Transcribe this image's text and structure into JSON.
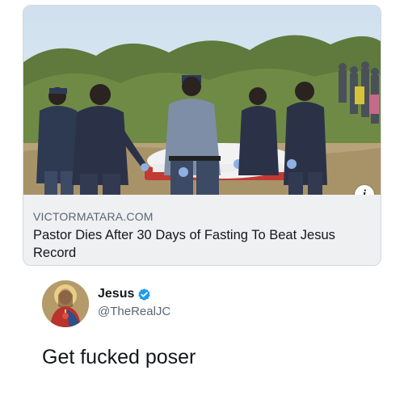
{
  "link_card": {
    "domain": "VICTORMATARA.COM",
    "title": "Pastor Dies After 30 Days of Fasting To Beat Jesus Record",
    "info_icon": "info-icon",
    "info_glyph": "i"
  },
  "reply": {
    "author_name": "Jesus",
    "author_handle": "@TheRealJC",
    "verified": true,
    "text": "Get fucked poser"
  },
  "colors": {
    "text_primary": "#14171a",
    "text_secondary": "#5b6670",
    "verified_blue": "#1d9bf0",
    "card_border": "#cfd9de",
    "card_background": "#eef0f2"
  }
}
